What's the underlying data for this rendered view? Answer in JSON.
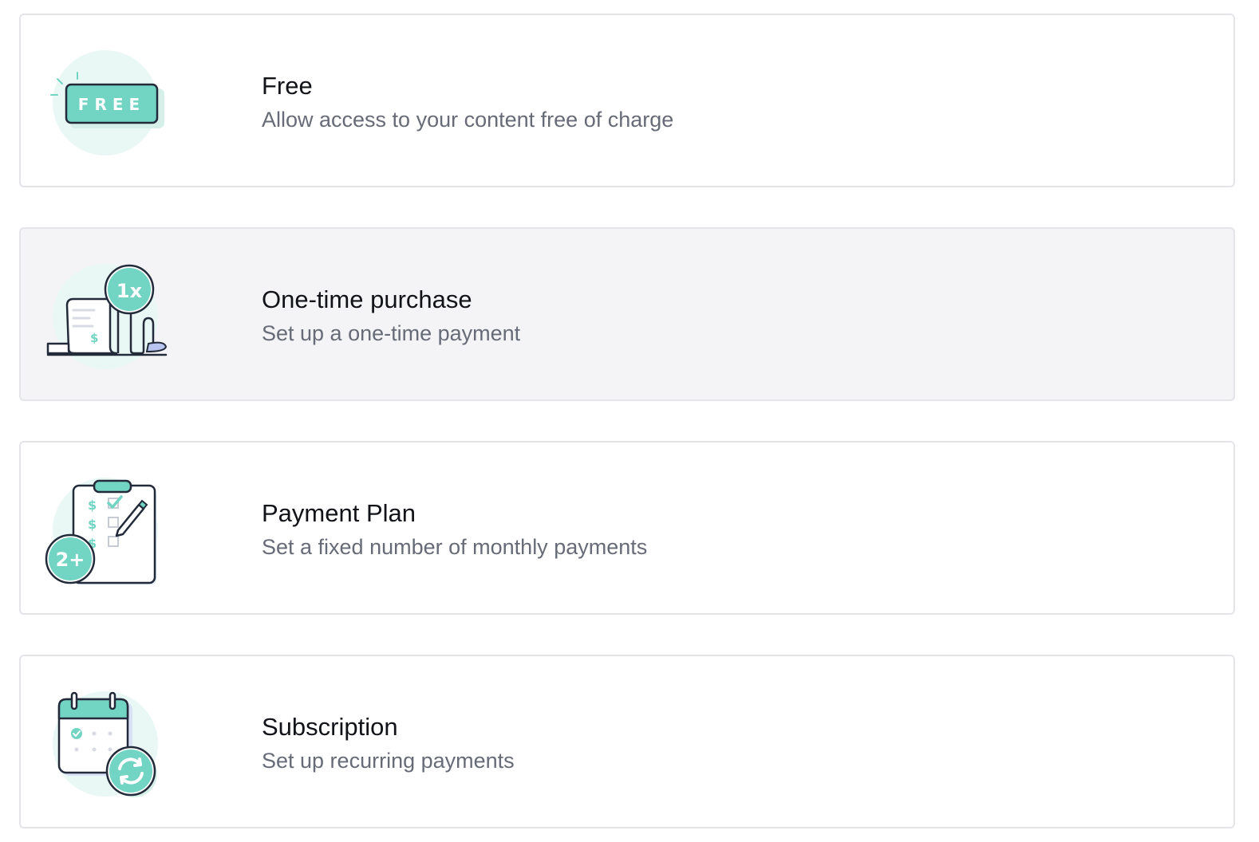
{
  "colors": {
    "accent": "#72d4c3",
    "accent_light": "#e9f8f5",
    "outline": "#232a3a",
    "card_border": "#e4e5e8",
    "card_hover_bg": "#f4f4f6",
    "title_text": "#111318",
    "desc_text": "#676b78"
  },
  "options": [
    {
      "icon": "free-ticket-icon",
      "title": "Free",
      "description": "Allow access to your content free of charge",
      "badge_text": "FREE"
    },
    {
      "icon": "receipt-coin-icon",
      "title": "One-time purchase",
      "description": "Set up a one-time payment",
      "badge_text": "1x"
    },
    {
      "icon": "clipboard-plan-icon",
      "title": "Payment Plan",
      "description": "Set a fixed number of monthly payments",
      "badge_text": "2+"
    },
    {
      "icon": "calendar-refresh-icon",
      "title": "Subscription",
      "description": "Set up recurring payments"
    }
  ]
}
